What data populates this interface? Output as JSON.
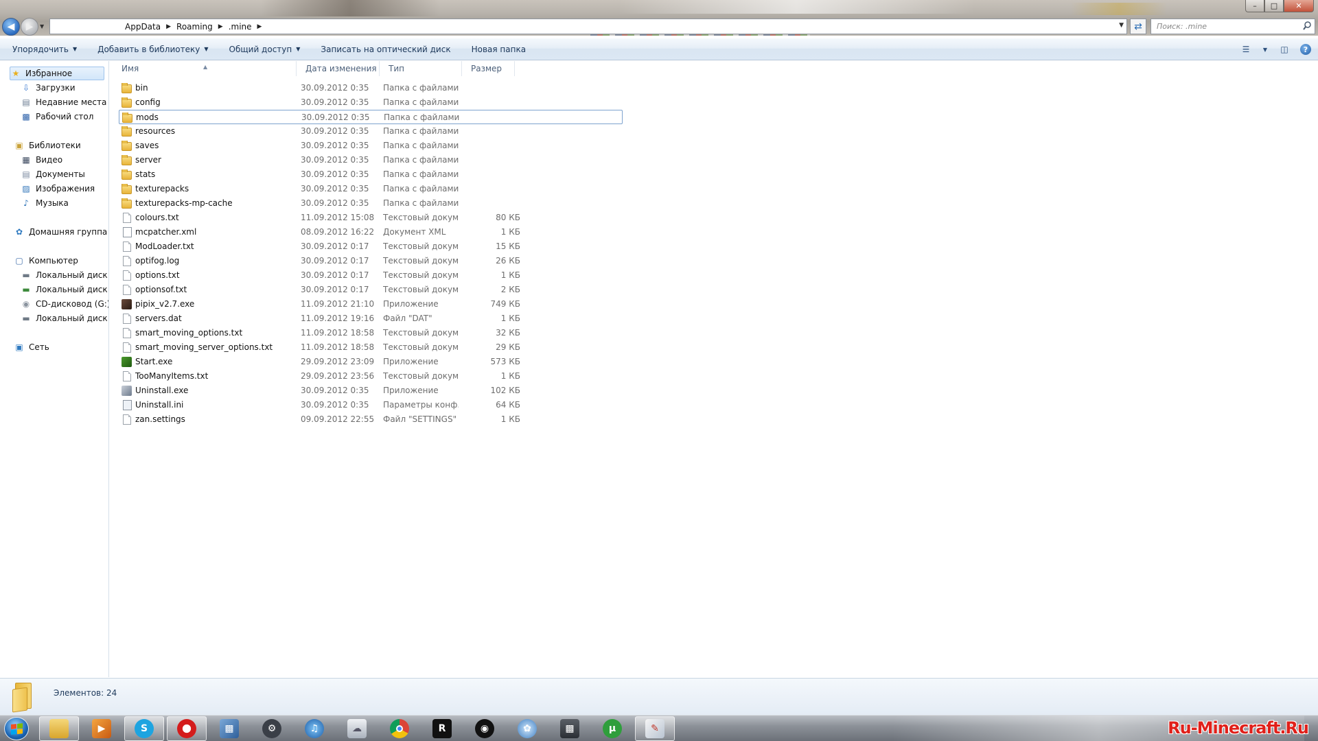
{
  "address": {
    "crumbs": [
      "AppData",
      "Roaming",
      ".mine"
    ]
  },
  "search": {
    "placeholder": "Поиск: .mine"
  },
  "window_controls": {
    "minimize": "–",
    "maximize": "□",
    "close": "✕"
  },
  "command_bar": {
    "organize": "Упорядочить",
    "add_to_library": "Добавить в библиотеку",
    "share": "Общий доступ",
    "burn": "Записать на оптический диск",
    "new_folder": "Новая папка"
  },
  "nav": {
    "favorites": "Избранное",
    "downloads": "Загрузки",
    "recent": "Недавние места",
    "desktop": "Рабочий стол",
    "libraries": "Библиотеки",
    "video": "Видео",
    "documents": "Документы",
    "pictures": "Изображения",
    "music": "Музыка",
    "homegroup": "Домашняя группа",
    "computer": "Компьютер",
    "disk_c": "Локальный диск (C",
    "disk_d": "Локальный диск (D",
    "cd_g": "CD-дисковод (G:)",
    "disk_h": "Локальный диск (H",
    "network": "Сеть"
  },
  "columns": {
    "name": "Имя",
    "date": "Дата изменения",
    "type": "Тип",
    "size": "Размер"
  },
  "files": [
    {
      "name": "bin",
      "date": "30.09.2012 0:35",
      "type": "Папка с файлами",
      "size": "",
      "icon": "folder-icon"
    },
    {
      "name": "config",
      "date": "30.09.2012 0:35",
      "type": "Папка с файлами",
      "size": "",
      "icon": "folder-icon"
    },
    {
      "name": "mods",
      "date": "30.09.2012 0:35",
      "type": "Папка с файлами",
      "size": "",
      "icon": "folder-icon",
      "selected": true
    },
    {
      "name": "resources",
      "date": "30.09.2012 0:35",
      "type": "Папка с файлами",
      "size": "",
      "icon": "folder-icon"
    },
    {
      "name": "saves",
      "date": "30.09.2012 0:35",
      "type": "Папка с файлами",
      "size": "",
      "icon": "folder-icon"
    },
    {
      "name": "server",
      "date": "30.09.2012 0:35",
      "type": "Папка с файлами",
      "size": "",
      "icon": "folder-icon"
    },
    {
      "name": "stats",
      "date": "30.09.2012 0:35",
      "type": "Папка с файлами",
      "size": "",
      "icon": "folder-icon"
    },
    {
      "name": "texturepacks",
      "date": "30.09.2012 0:35",
      "type": "Папка с файлами",
      "size": "",
      "icon": "folder-icon"
    },
    {
      "name": "texturepacks-mp-cache",
      "date": "30.09.2012 0:35",
      "type": "Папка с файлами",
      "size": "",
      "icon": "folder-icon"
    },
    {
      "name": "colours.txt",
      "date": "11.09.2012 15:08",
      "type": "Текстовый докум...",
      "size": "80 КБ",
      "icon": "text-file-icon"
    },
    {
      "name": "mcpatcher.xml",
      "date": "08.09.2012 16:22",
      "type": "Документ XML",
      "size": "1 КБ",
      "icon": "xml-file-icon"
    },
    {
      "name": "ModLoader.txt",
      "date": "30.09.2012 0:17",
      "type": "Текстовый докум...",
      "size": "15 КБ",
      "icon": "text-file-icon"
    },
    {
      "name": "optifog.log",
      "date": "30.09.2012 0:17",
      "type": "Текстовый докум...",
      "size": "26 КБ",
      "icon": "text-file-icon"
    },
    {
      "name": "options.txt",
      "date": "30.09.2012 0:17",
      "type": "Текстовый докум...",
      "size": "1 КБ",
      "icon": "text-file-icon"
    },
    {
      "name": "optionsof.txt",
      "date": "30.09.2012 0:17",
      "type": "Текстовый докум...",
      "size": "2 КБ",
      "icon": "text-file-icon"
    },
    {
      "name": "pipix_v2.7.exe",
      "date": "11.09.2012 21:10",
      "type": "Приложение",
      "size": "749 КБ",
      "icon": "pipix-app-icon"
    },
    {
      "name": "servers.dat",
      "date": "11.09.2012 19:16",
      "type": "Файл \"DAT\"",
      "size": "1 КБ",
      "icon": "text-file-icon"
    },
    {
      "name": "smart_moving_options.txt",
      "date": "11.09.2012 18:58",
      "type": "Текстовый докум...",
      "size": "32 КБ",
      "icon": "text-file-icon"
    },
    {
      "name": "smart_moving_server_options.txt",
      "date": "11.09.2012 18:58",
      "type": "Текстовый докум...",
      "size": "29 КБ",
      "icon": "text-file-icon"
    },
    {
      "name": "Start.exe",
      "date": "29.09.2012 23:09",
      "type": "Приложение",
      "size": "573 КБ",
      "icon": "start-app-icon"
    },
    {
      "name": "TooManyItems.txt",
      "date": "29.09.2012 23:56",
      "type": "Текстовый докум...",
      "size": "1 КБ",
      "icon": "text-file-icon"
    },
    {
      "name": "Uninstall.exe",
      "date": "30.09.2012 0:35",
      "type": "Приложение",
      "size": "102 КБ",
      "icon": "uninstall-app-icon"
    },
    {
      "name": "Uninstall.ini",
      "date": "30.09.2012 0:35",
      "type": "Параметры конф...",
      "size": "64 КБ",
      "icon": "ini-file-icon"
    },
    {
      "name": "zan.settings",
      "date": "09.09.2012 22:55",
      "type": "Файл \"SETTINGS\"",
      "size": "1 КБ",
      "icon": "text-file-icon"
    }
  ],
  "details": {
    "item_count": "Элементов: 24"
  },
  "taskbar": {
    "apps": [
      "explorer",
      "media-player",
      "skype",
      "opera",
      "control-panel",
      "steam",
      "itunes",
      "cloud-app",
      "chrome",
      "rockstar-social-club",
      "panda-app",
      "network-app",
      "server-app",
      "utorrent",
      "paint"
    ],
    "watermark": "Ru-Minecraft.Ru"
  }
}
